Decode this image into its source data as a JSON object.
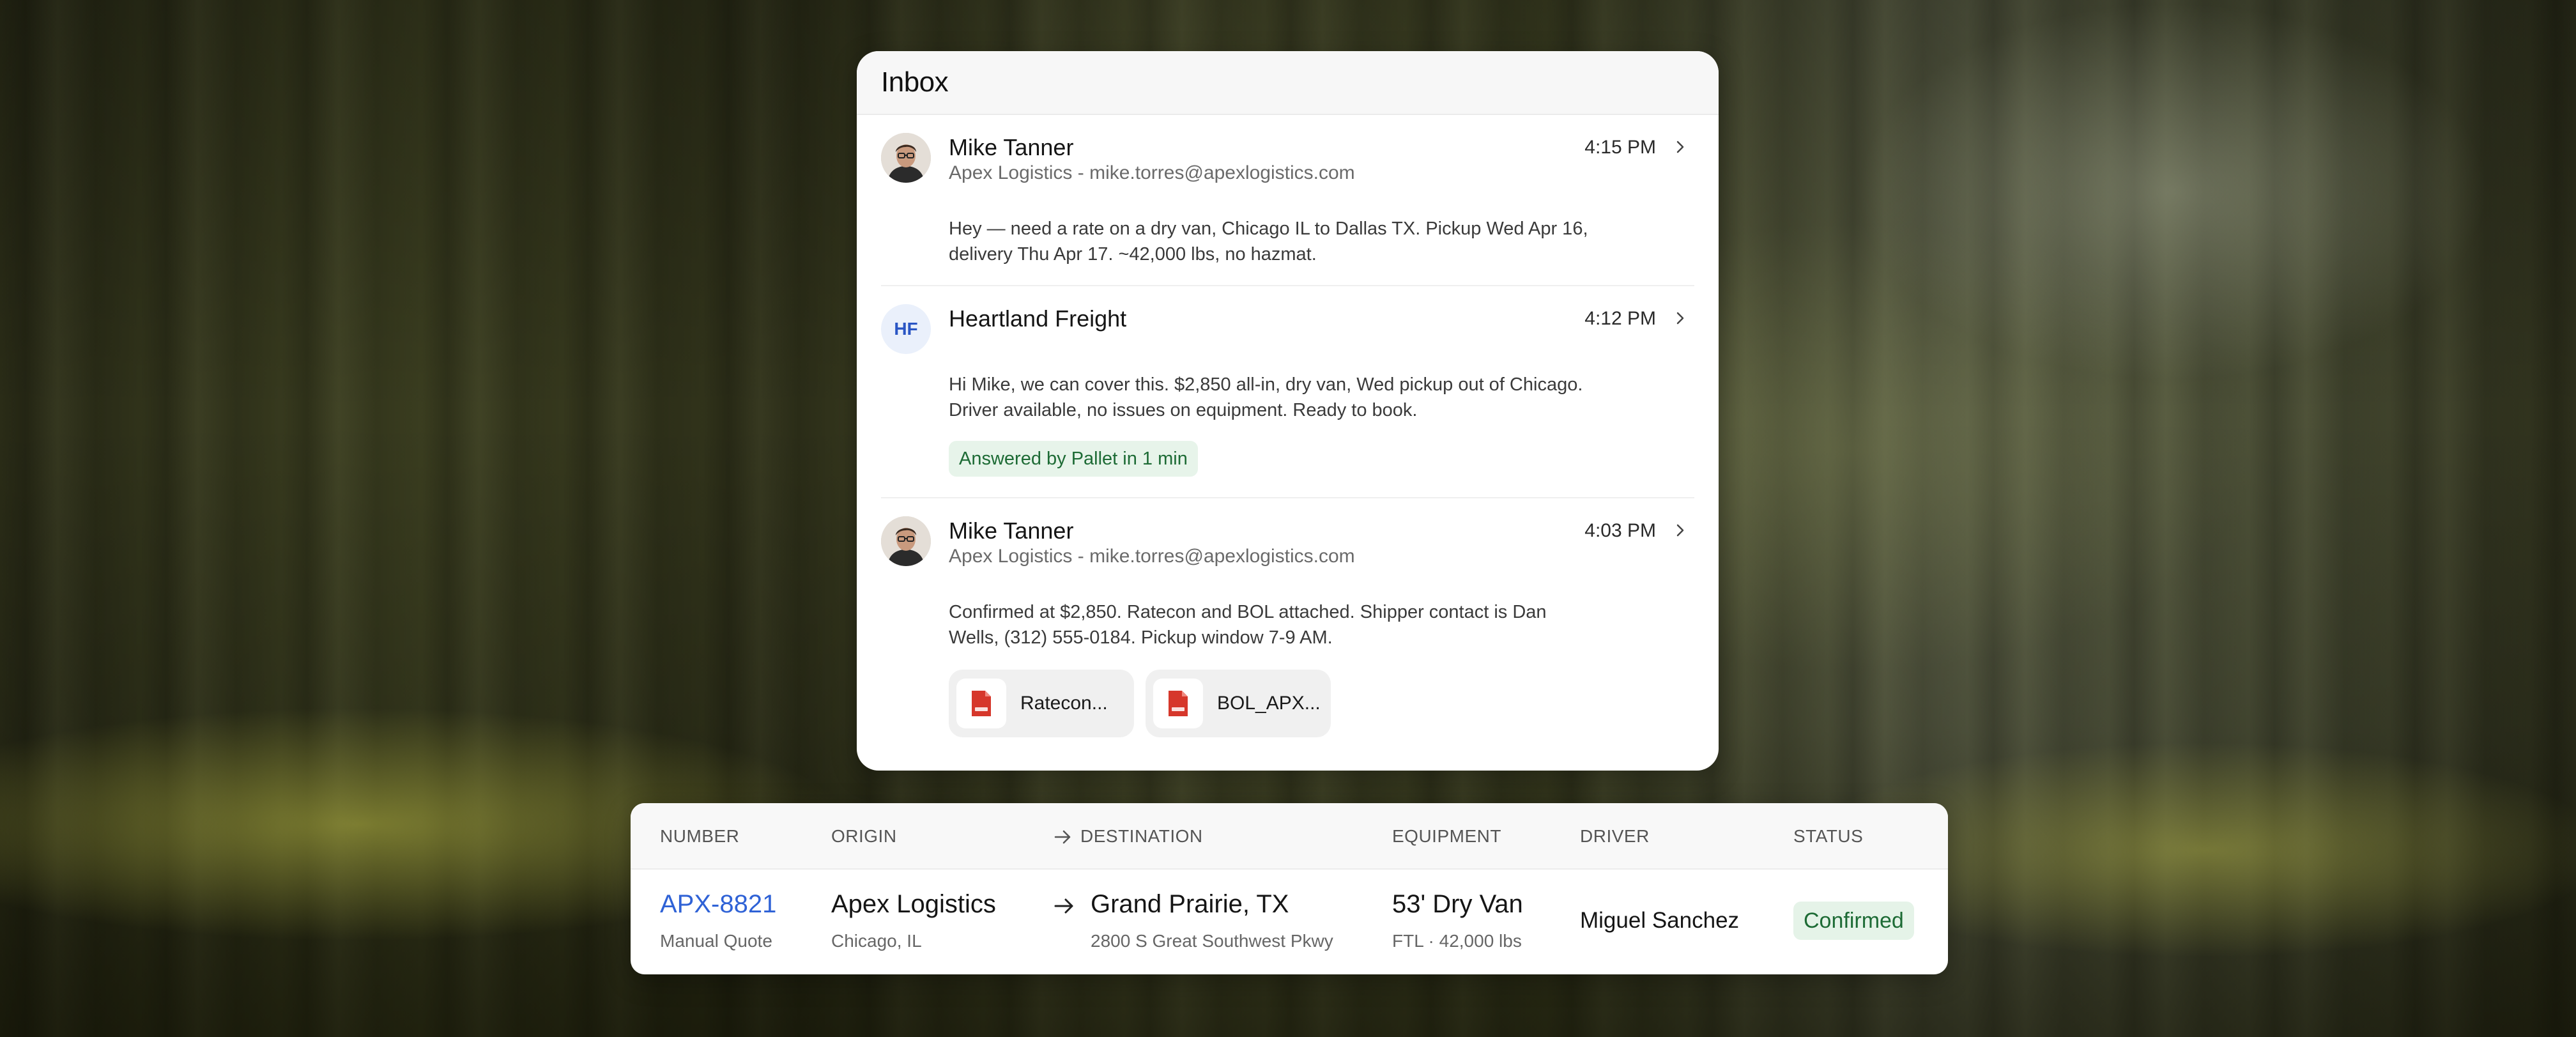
{
  "inbox": {
    "title": "Inbox",
    "messages": [
      {
        "sender": "Mike Tanner",
        "subline": "Apex Logistics - mike.torres@apexlogistics.com",
        "time": "4:15 PM",
        "body": "Hey — need a rate on a dry van, Chicago IL to Dallas TX. Pickup Wed Apr 16, delivery Thu Apr 17. ~42,000 lbs, no hazmat.",
        "avatar": "photo"
      },
      {
        "sender": "Heartland Freight",
        "initials": "HF",
        "time": "4:12 PM",
        "body": "Hi Mike, we can cover this. $2,850 all-in, dry van, Wed pickup out of Chicago. Driver available, no issues on equipment. Ready to book.",
        "badge": "Answered by Pallet in 1 min"
      },
      {
        "sender": "Mike Tanner",
        "subline": "Apex Logistics - mike.torres@apexlogistics.com",
        "time": "4:03 PM",
        "body": "Confirmed at $2,850. Ratecon and BOL attached. Shipper contact is Dan Wells, (312) 555-0184. Pickup window 7-9 AM.",
        "avatar": "photo",
        "attachments": [
          {
            "name": "Ratecon...",
            "icon": "pdf-file-icon"
          },
          {
            "name": "BOL_APX...",
            "icon": "pdf-file-icon"
          }
        ]
      }
    ]
  },
  "load_table": {
    "headers": {
      "number": "NUMBER",
      "origin": "ORIGIN",
      "destination": "DESTINATION",
      "equipment": "EQUIPMENT",
      "driver": "DRIVER",
      "status": "STATUS"
    },
    "row": {
      "number": "APX-8821",
      "number_sub": "Manual Quote",
      "origin": "Apex Logistics",
      "origin_sub": "Chicago, IL",
      "destination": "Grand Prairie, TX",
      "destination_sub": "2800 S Great Southwest Pkwy",
      "equipment": "53' Dry Van",
      "equipment_sub": "FTL · 42,000 lbs",
      "driver": "Miguel Sanchez",
      "status": "Confirmed"
    }
  },
  "colors": {
    "link_blue": "#2f62d6",
    "status_green_bg": "#e5f3e8",
    "status_green_text": "#1d6b35",
    "pdf_red": "#d6372b"
  }
}
